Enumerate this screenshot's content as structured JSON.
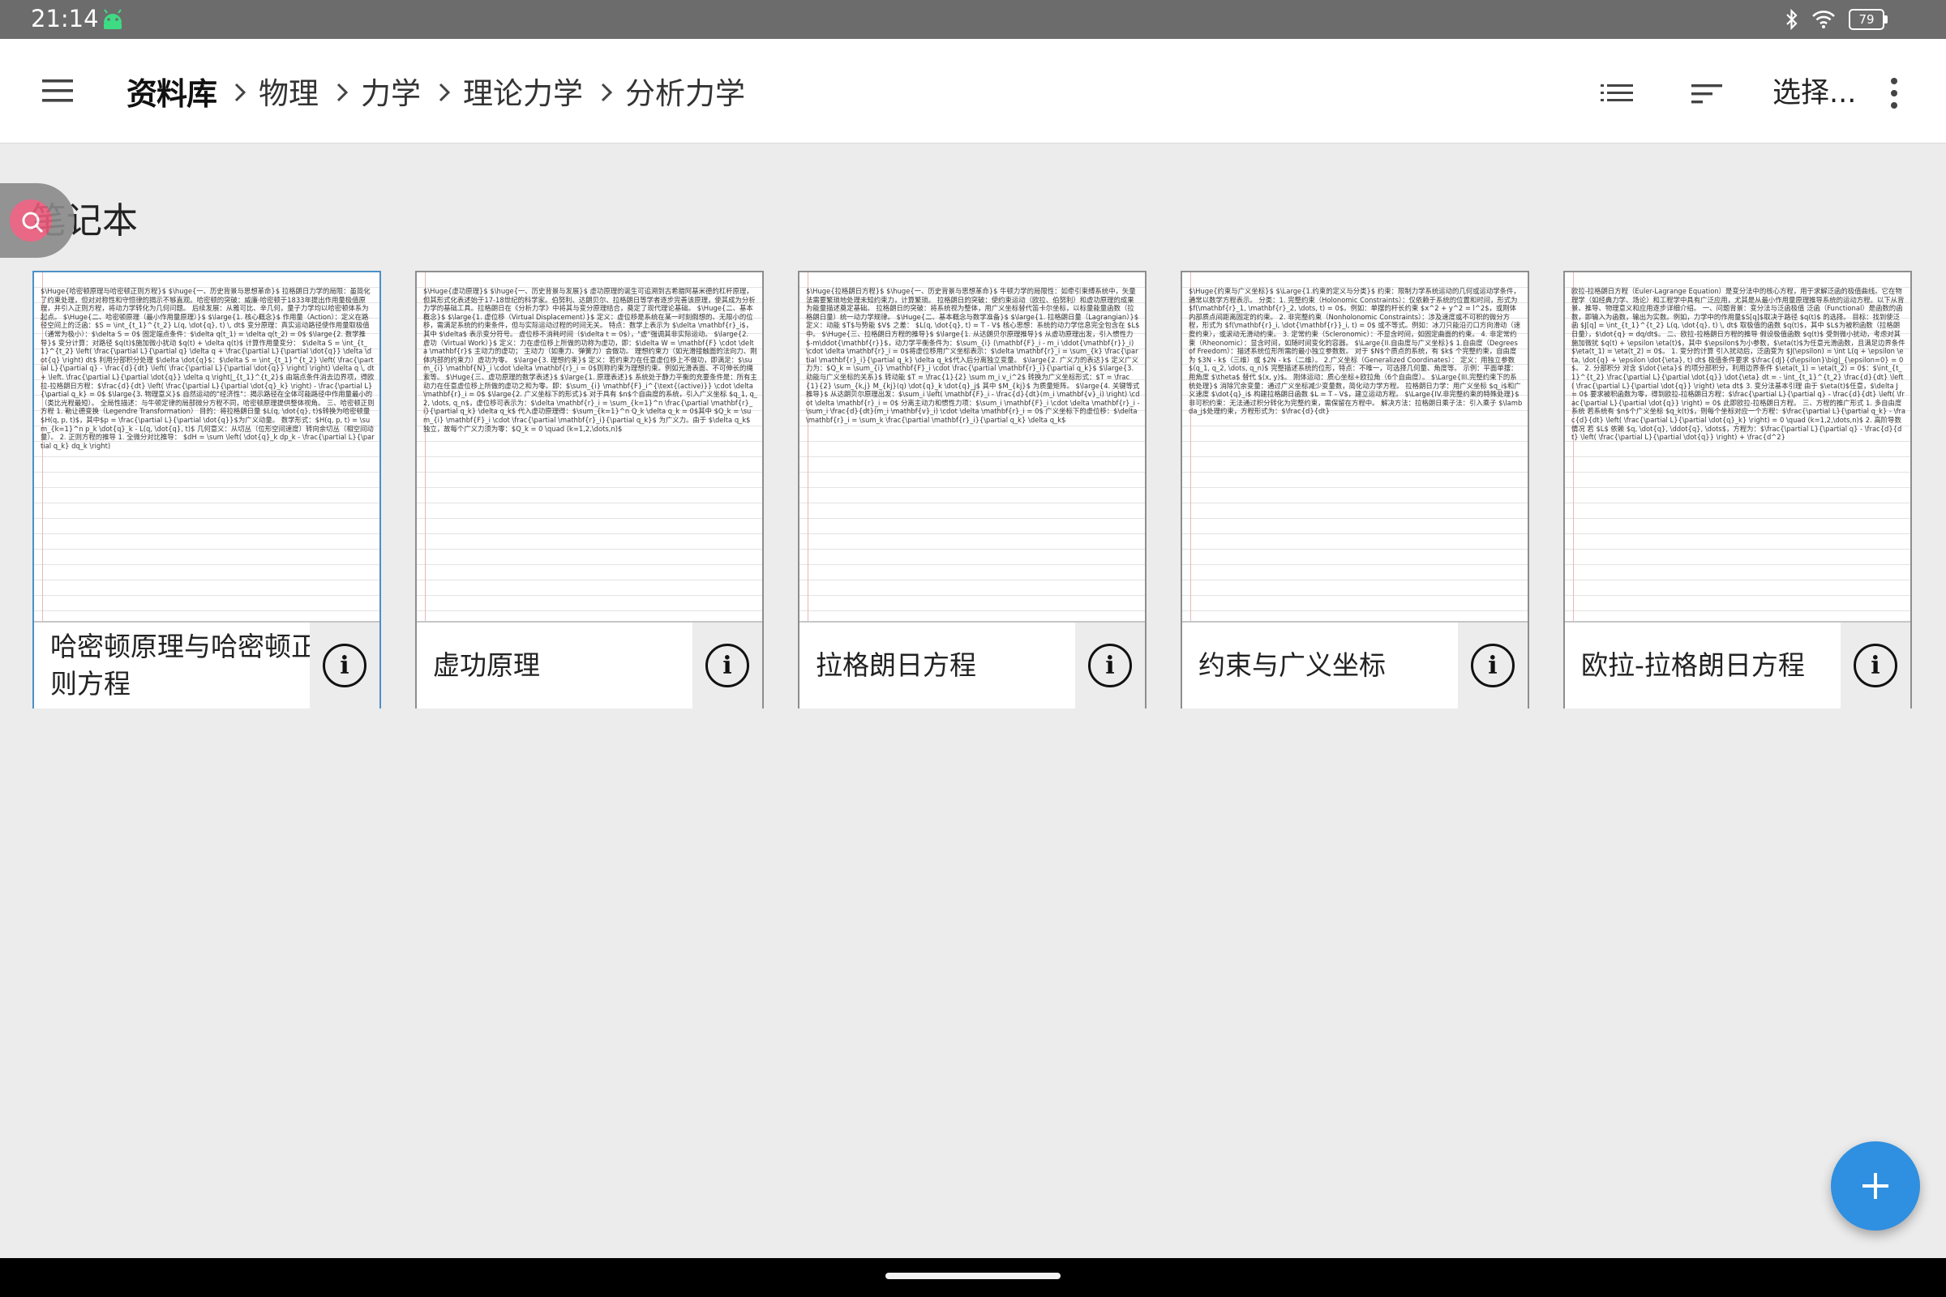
{
  "status_bar": {
    "time": "21:14",
    "app_icon": "android-robot-icon",
    "icons": [
      "bluetooth-icon",
      "wifi-icon",
      "battery-icon"
    ],
    "battery_level": "79"
  },
  "app_bar": {
    "menu_icon": "hamburger-menu-icon",
    "breadcrumb": {
      "root": "资料库",
      "items": [
        "物理",
        "力学",
        "理论力学",
        "分析力学"
      ]
    },
    "view_icon": "list-view-icon",
    "sort_icon": "sort-icon",
    "select_label": "选择...",
    "more_icon": "more-vert-icon"
  },
  "section": {
    "title": "笔记本"
  },
  "notebooks": [
    {
      "title": "哈密顿原理与哈密顿正则方程",
      "preview": "$\\Huge{哈密顿原理与哈密顿正则方程}$ $\\huge{一、历史背景与思想革命}$ 拉格朗日力学的局限：虽简化了约束处理，但对对称性和守恒律的揭示不够直观。哈密顿的突破：威廉·哈密顿于1833年提出作用量极值原理，并引入正则方程，将动力学转化为几何问题。 后续发展：从雅可比、辛几何，量子力学均以哈密顿体系为起点。 $\\Huge{二、哈密顿原理（最小作用量原理）}$ $\\large{1. 核心概念}$ 作用量（Action）：定义在路径空间上的泛函：$S = \\int_{t_1}^{t_2} L(q, \\dot{q}, t) \\, dt$ 变分原理：真实运动路径使作用量取极值（通常为极小）：$\\delta S = 0$ 固定端点条件：$\\delta q(t_1) = \\delta q(t_2) = 0$ $\\large{2. 数学推导}$ 变分计算：对路径 $q(t)$施加微小扰动 $q(t) + \\delta q(t)$ 计算作用量变分： $\\delta S = \\int_{t_1}^{t_2} \\left( \\frac{\\partial L}{\\partial q} \\delta q + \\frac{\\partial L}{\\partial \\dot{q}} \\delta \\dot{q} \\right) dt$ 利用分部积分处理 $\\delta \\dot{q}$：$\\delta S = \\int_{t_1}^{t_2} \\left( \\frac{\\partial L}{\\partial q} - \\frac{d}{dt} \\left( \\frac{\\partial L}{\\partial \\dot{q}} \\right) \\right) \\delta q \\, dt + \\left. \\frac{\\partial L}{\\partial \\dot{q}} \\delta q \\right|_{t_1}^{t_2}$ 由端点条件消去边界项，得欧拉-拉格朗日方程：$\\frac{d}{dt} \\left( \\frac{\\partial L}{\\partial \\dot{q}_k} \\right) - \\frac{\\partial L}{\\partial q_k} = 0$ $\\large{3. 物理意义}$ 自然运动的\"经济性\"：揭示路径在全体可能路径中作用量最小的（类比光程最短）。 全局性描述：与牛顿定律的局部微分方程不同，哈密顿原理提供整体视角。 三、哈密顿正则方程 1. 勒让德变换（Legendre Transformation） 目的：将拉格朗日量 $L(q, \\dot{q}, t)$转换为哈密顿量 $H(q, p, t)$，其中$p = \\frac{\\partial L}{\\partial \\dot{q}}$为广义动量。 数学形式：$H(q, p, t) = \\sum_{k=1}^n p_k \\dot{q}_k - L(q, \\dot{q}, t)$ 几何意义：从切丛（位形空间速度）转向余切丛（相空间动量）。 2. 正则方程的推导 1. 全微分对比推导： $dH = \\sum \\left( \\dot{q}_k dp_k - \\frac{\\partial L}{\\partial q_k} dq_k \\right)",
      "selected": true
    },
    {
      "title": "虚功原理",
      "preview": "$\\Huge{虚功原理}$ $\\huge{一、历史背景与发展}$ 虚功原理的诞生可追溯到古希腊阿基米德的杠杆原理，但其形式化表述始于17-18世纪的科学家。伯努利、达朗贝尔、拉格朗日等学者逐步完善该原理，使其成为分析力学的基础工具。拉格朗日在《分析力学》中将其与变分原理结合，奠定了现代理论基础。 $\\Huge{二、基本概念}$ $\\large{1. 虚位移（Virtual Displacement）}$ 定义：虚位移是系统在某一时刻假想的、无限小的位移，需满足系统的约束条件，但与实际运动过程的时间无关。 特点：数学上表示为 $\\delta \\mathbf{r}_i$，其中 $\\delta$ 表示变分符号。 虚位移不消耗时间（$\\delta t = 0$），\"虚\"强调其非实际运动。 $\\large{2. 虚功（Virtual Work）}$ 定义：力在虚位移上所做的功称为虚功，即：$\\delta W = \\mathbf{F} \\cdot \\delta \\mathbf{r}$ 主动力的虚功； 主动力（如重力、弹簧力）会做功。 理想约束力（如光滑接触面的法向力、刚体内部的约束力）虚功为零。 $\\large{3. 理想约束}$ 定义：若约束力在任意虚位移上不做功，即满足：$\\sum_{i} \\mathbf{N}_i \\cdot \\delta \\mathbf{r}_i = 0$则称约束为理想约束。例如光滑表面、不可伸长的绳索等。 $\\Huge{三、虚功原理的数学表述}$ $\\large{1. 原理表述}$ 系统处于静力平衡的充要条件是：所有主动力在任意虚位移上所做的虚功之和为零。即：$\\sum_{i} \\mathbf{F}_i^{\\text{(active)}} \\cdot \\delta \\mathbf{r}_i = 0$ $\\large{2. 广义坐标下的形式}$ 对于具有 $n$个自由度的系统，引入广义坐标 $q_1, q_2, \\dots, q_n$，虚位移可表示为：$\\delta \\mathbf{r}_i = \\sum_{k=1}^n \\frac{\\partial \\mathbf{r}_i}{\\partial q_k} \\delta q_k$ 代入虚功原理得：$\\sum_{k=1}^n Q_k \\delta q_k = 0$其中 $Q_k = \\sum_{i} \\mathbf{F}_i \\cdot \\frac{\\partial \\mathbf{r}_i}{\\partial q_k}$ 为广义力。由于 $\\delta q_k$ 独立，故每个广义力须为零：$Q_k = 0 \\quad (k=1,2,\\dots,n)$",
      "selected": false
    },
    {
      "title": "拉格朗日方程",
      "preview": "$\\Huge{拉格朗日方程}$ $\\huge{一、历史背景与思想革命}$ 牛顿力学的局限性：如牵引束缚系统中，矢量法需要繁琐地处理未知约束力，计算繁琐。 拉格朗日的突破：使约束运动（欧拉、伯努利）和虚功原理的成果为能量描述奠定基础。 拉格朗日的突破：将系统视为整体，用广义坐标替代笛卡尔坐标，以标量能量函数（拉格朗日量）统一动力学规律。 $\\Huge{二、基本概念与数学准备}$ $\\large{1. 拉格朗日量（Lagrangian）}$ 定义：动能 $T$与势能 $V$ 之差： $L(q, \\dot{q}, t) = T - V$ 核心思想：系统的动力学信息完全包含在 $L$ 中。 $\\Huge{三、拉格朗日方程的推导}$ $\\large{1. 从达朗贝尔原理推导}$ 从虚功原理出发，引入惯性力 $-m\\ddot{\\mathbf{r}}$，动力学平衡条件为：$\\sum_{i} (\\mathbf{F}_i - m_i \\ddot{\\mathbf{r}}_i) \\cdot \\delta \\mathbf{r}_i = 0$将虚位移用广义坐标表示：$\\delta \\mathbf{r}_i = \\sum_{k} \\frac{\\partial \\mathbf{r}_i}{\\partial q_k} \\delta q_k$代入后分离独立变量。 $\\large{2. 广义力的表达}$ 定义广义力为：$Q_k = \\sum_{i} \\mathbf{F}_i \\cdot \\frac{\\partial \\mathbf{r}_i}{\\partial q_k}$ $\\large{3. 动能与广义坐标的关系}$ 转动能 $T = \\frac{1}{2} \\sum m_i v_i^2$ 转换为广义坐标形式：$T = \\frac{1}{2} \\sum_{k,j} M_{kj}(q) \\dot{q}_k \\dot{q}_j$ 其中 $M_{kj}$ 为质量矩阵。 $\\large{4. 关键等式推导}$ 从达朗贝尔原理出发：$\\sum_i \\left( \\mathbf{F}_i - \\frac{d}{dt}(m_i \\mathbf{v}_i) \\right) \\cdot \\delta \\mathbf{r}_i = 0$ 分离主动力和惯性力项：$\\sum_i \\mathbf{F}_i \\cdot \\delta \\mathbf{r}_i - \\sum_i \\frac{d}{dt}(m_i \\mathbf{v}_i) \\cdot \\delta \\mathbf{r}_i = 0$ 广义坐标下的虚位移：$\\delta \\mathbf{r}_i = \\sum_k \\frac{\\partial \\mathbf{r}_i}{\\partial q_k} \\delta q_k$",
      "selected": false
    },
    {
      "title": "约束与广义坐标",
      "preview": "$\\Huge{约束与广义坐标}$ $\\Large{1.约束的定义与分类}$ 约束：限制力学系统运动的几何或运动学条件，通常以数学方程表示。 分类：1. 完整约束（Holonomic Constraints）：仅依赖于系统的位置和时间，形式为 $f(\\mathbf{r}_1, \\mathbf{r}_2, \\dots, t) = 0$。例如：单摆的杆长约束 $x^2 + y^2 = l^2$，或刚体内部质点间距离固定的约束。 2. 非完整约束（Nonholonomic Constraints）：涉及速度或不可积的微分方程，形式为 $f(\\mathbf{r}_i, \\dot{\\mathbf{r}}_i, t) = 0$ 或不等式。例如：冰刀只能沿刃口方向滑动（速度约束），或滚动无滑动约束。 3. 定常约束（Scleronomic）：不显含时间，如固定曲面的约束。 4. 非定常约束（Rheonomic）：显含时间，如随时间变化的容器。 $\\Large{II.自由度与广义坐标}$ 1.自由度（Degrees of Freedom）：描述系统位形所需的最小独立参数数。 对于 $N$个质点的系统，有 $k$ 个完整约束，自由度为 $3N - k$（三维）或 $2N - k$（二维）。 2.广义坐标（Generalized Coordinates）： 定义：用独立参数 $(q_1, q_2, \\dots, q_n)$ 完整描述系统的位形，特点：不唯一，可选择几何量、角度等。 示例：平面单摆：用角度 $\\theta$ 替代 $(x, y)$。 刚体运动：质心坐标+欧拉角（6个自由度）。 $\\Large{III.完整约束下的系统处理}$ 消除冗余变量：通过广义坐标减少变量数，简化动力学方程。 拉格朗日力学：用广义坐标 $q_i$和广义速度 $\\dot{q}_i$ 构建拉格朗日函数 $L = T - V$，建立运动方程。 $\\Large{IV.非完整约束的特殊处理}$ 非可积约束：无法通过积分转化为完整约束，需保留在方程中。 解决方法：拉格朗日乘子法：引入乘子 $\\lambda_j$处理约束，方程形式为：$\\frac{d}{dt}",
      "selected": false
    },
    {
      "title": "欧拉-拉格朗日方程",
      "preview": "欧拉-拉格朗日方程（Euler-Lagrange Equation）是变分法中的核心方程，用于求解泛函的极值曲线。它在物理学（如经典力学、场论）和工程学中具有广泛应用，尤其是从最小作用量原理推导系统的运动方程。以下从背景、推导、物理意义和应用逐步详细介绍。 一、问题背景：变分法与泛函极值 泛函（Functional）是函数的函数，即输入为函数，输出为实数。例如，力学中的作用量$S[q]$取决于路径 $q(t)$ 的选择。 目标：找到使泛函 $J[q] = \\int_{t_1}^{t_2} L(q, \\dot{q}, t) \\, dt$ 取极值的函数 $q(t)$，其中 $L$为被积函数（拉格朗日量），$\\dot{q} = dq/dt$。 二、欧拉-拉格朗日方程的推导 假设极值函数 $q(t)$ 受到微小扰动，考虑对其施加微扰 $q(t) + \\epsilon \\eta(t)$，其中 $\\epsilon$为小参数，$\\eta(t)$为任意光滑函数，且满足边界条件 $\\eta(t_1) = \\eta(t_2) = 0$。 1. 变分的计算 引入扰动后，泛函变为 $J(\\epsilon) = \\int L(q + \\epsilon \\eta, \\dot{q} + \\epsilon \\dot{\\eta}, t) dt$ 极值条件要求 $\\frac{dJ}{d\\epsilon}\\big|_{\\epsilon=0} = 0$。 2. 分部积分 对含 $\\dot{\\eta}$ 的项分部积分，利用边界条件 $\\eta(t_1) = \\eta(t_2) = 0$：$\\int_{t_1}^{t_2} \\frac{\\partial L}{\\partial \\dot{q}} \\dot{\\eta} dt = - \\int_{t_1}^{t_2} \\frac{d}{dt} \\left( \\frac{\\partial L}{\\partial \\dot{q}} \\right) \\eta dt$ 3. 变分法基本引理 由于 $\\eta(t)$任意，$\\delta J = 0$ 要求被积函数为零，得到欧拉-拉格朗日方程：$\\frac{\\partial L}{\\partial q} - \\frac{d}{dt} \\left( \\frac{\\partial L}{\\partial \\dot{q}} \\right) = 0$ 此即欧拉-拉格朗日方程。 三、方程的推广形式 1. 多自由度系统 若系统有 $n$个广义坐标 $q_k(t)$，则每个坐标对应一个方程：$\\frac{\\partial L}{\\partial q_k} - \\frac{d}{dt} \\left( \\frac{\\partial L}{\\partial \\dot{q}_k} \\right) = 0 \\quad (k=1,2,\\dots,n)$ 2. 高阶导数情况 若 $L$ 依赖 $q, \\dot{q}, \\ddot{q}, \\dots$，方程为：$\\frac{\\partial L}{\\partial q} - \\frac{d}{dt} \\left( \\frac{\\partial L}{\\partial \\dot{q}} \\right) + \\frac{d^2}",
      "selected": false
    }
  ],
  "fab": {
    "icon": "add-icon"
  },
  "floating_tool": {
    "icon": "floating-pen-icon"
  },
  "nav_bar": {
    "icon": "gesture-handle-icon"
  }
}
